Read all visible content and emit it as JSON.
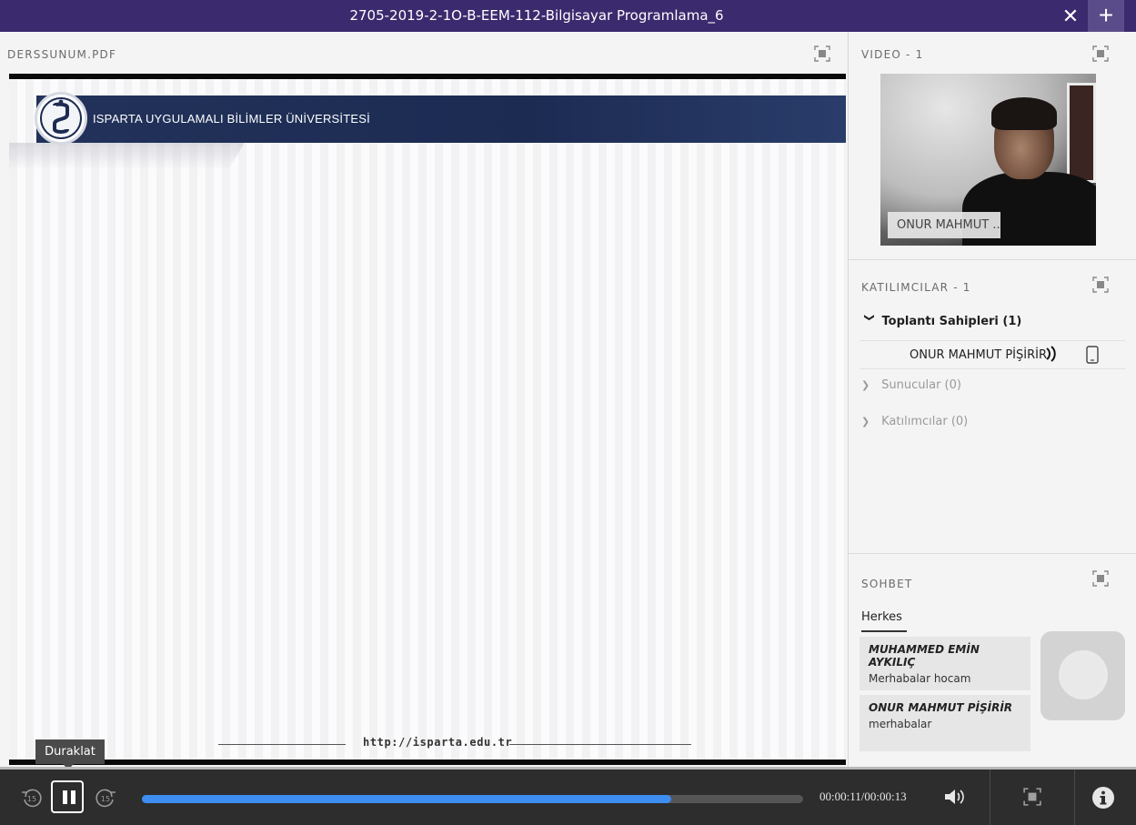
{
  "window": {
    "title": "2705-2019-2-1O-B-EEM-112-Bilgisayar Programlama_6",
    "close_glyph": "✕",
    "add_glyph": "+"
  },
  "document_pod": {
    "label": "DERSSUNUM.PDF",
    "slide": {
      "header_text": "ISPARTA UYGULAMALI BİLİMLER ÜNİVERSİTESİ",
      "footer_url": "http://isparta.edu.tr"
    }
  },
  "video_pod": {
    "label": "VIDEO - 1",
    "name_tag": "ONUR MAHMUT ..."
  },
  "attendees_pod": {
    "label": "KATILIMCILAR - 1",
    "groups": [
      {
        "label": "Toplantı Sahipleri (1)",
        "chevron": "❯",
        "expanded": true
      },
      {
        "label": "Sunucular (0)",
        "chevron": "❯",
        "expanded": false
      },
      {
        "label": "Katılımcılar (0)",
        "chevron": "❯",
        "expanded": false
      }
    ],
    "host": {
      "name": "ONUR MAHMUT PİŞİRİR"
    }
  },
  "chat_pod": {
    "label": "SOHBET",
    "tab": "Herkes",
    "messages": [
      {
        "sender": "MUHAMMED EMİN AYKILIÇ",
        "text": "Merhabalar hocam"
      },
      {
        "sender": "ONUR MAHMUT PİŞİRİR",
        "text": "merhabalar"
      }
    ]
  },
  "playback": {
    "tooltip": "Duraklat",
    "time": "00:00:11/00:00:13",
    "progress": 0.8,
    "rewind_label": "15",
    "forward_label": "15"
  },
  "colors": {
    "titlebar": "#3c2a6e",
    "progress": "#3d8ef0",
    "bottombar": "#2d2d2d"
  }
}
